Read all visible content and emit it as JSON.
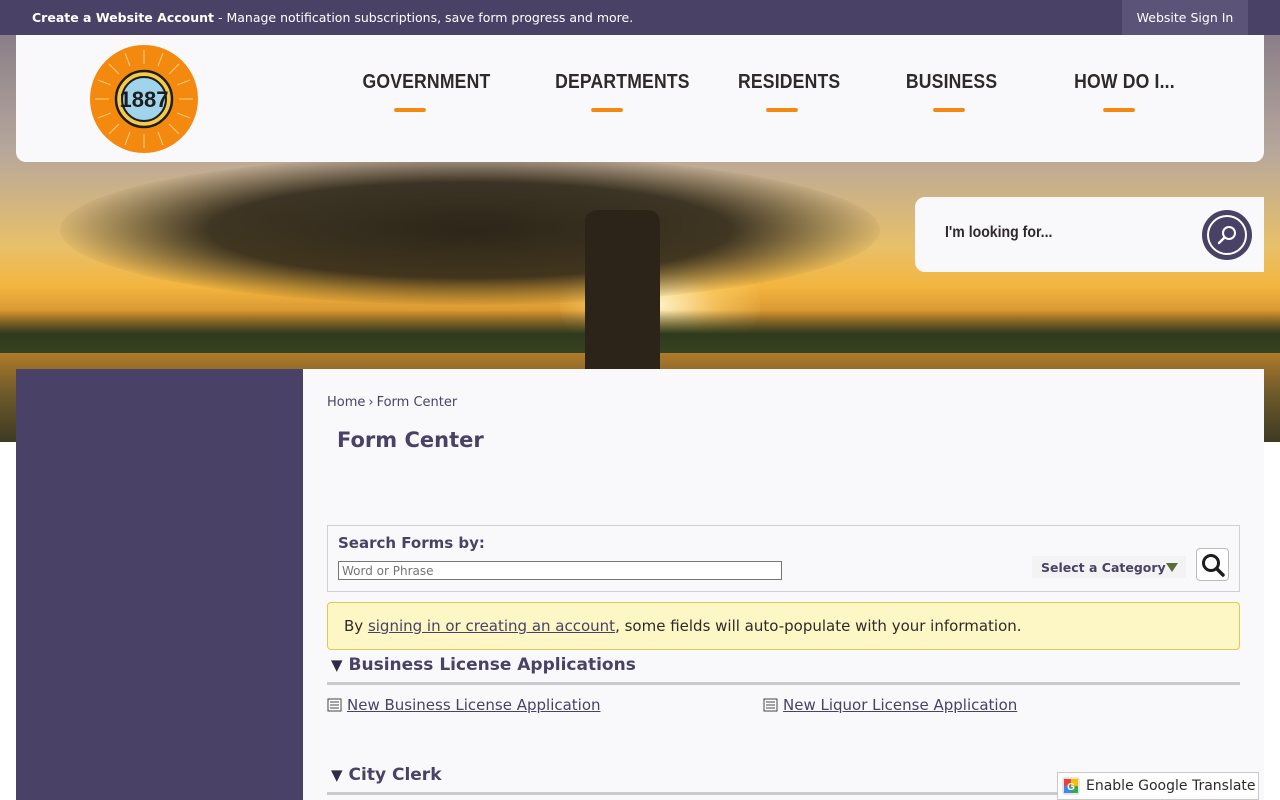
{
  "topbar": {
    "create_account": "Create a Website Account",
    "message": " - Manage notification subscriptions, save form progress and more.",
    "sign_in": "Website Sign In"
  },
  "logo": {
    "text": "1887"
  },
  "nav": [
    {
      "label": "GOVERNMENT"
    },
    {
      "label": "DEPARTMENTS"
    },
    {
      "label": "RESIDENTS"
    },
    {
      "label": "BUSINESS"
    },
    {
      "label": "HOW DO I..."
    }
  ],
  "site_search": {
    "placeholder": "I'm looking for..."
  },
  "breadcrumb": {
    "home": "Home",
    "separator": "›",
    "current": "Form Center"
  },
  "page_title": "Form Center",
  "search_forms": {
    "label": "Search Forms by:",
    "input_placeholder": "Word or Phrase",
    "category_label": "Select a Category"
  },
  "notice": {
    "prefix": "By ",
    "link": "signing in or creating an account",
    "suffix": ", some fields will auto-populate with your information."
  },
  "sections": [
    {
      "title": "Business License Applications",
      "forms": [
        "New Business License Application",
        "New Liquor License Application"
      ]
    },
    {
      "title": "City Clerk",
      "forms": []
    }
  ],
  "translate": {
    "label": "Enable Google Translate"
  },
  "colors": {
    "brand_purple": "#4a4266",
    "accent_orange": "#f3890f",
    "notice_bg": "#fdf6c5"
  }
}
